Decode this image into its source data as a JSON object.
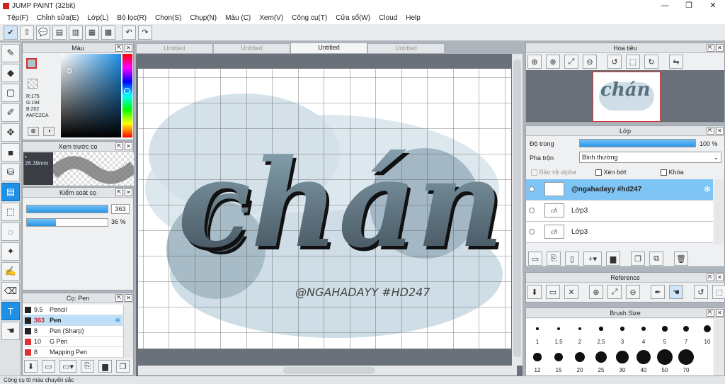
{
  "app": {
    "title": "JUMP PAINT (32bit)"
  },
  "menu": [
    "Tệp(F)",
    "Chỉnh sửa(E)",
    "Lớp(L)",
    "Bộ lọc(R)",
    "Chọn(S)",
    "Chụp(N)",
    "Màu (C)",
    "Xem(V)",
    "Công cụ(T)",
    "Cửa sổ(W)",
    "Cloud",
    "Help"
  ],
  "color_panel": {
    "title": "Màu",
    "r": "R:175",
    "g": "G:194",
    "b": "B:202",
    "hex": "#AFC2CA"
  },
  "preview_panel": {
    "title": "Xem trước cọ",
    "size": "26.39mm"
  },
  "brush_control": {
    "title": "Kiểm soát cọ",
    "size_value": "363",
    "opacity_value": "36 %"
  },
  "brush_panel": {
    "title": "Cọ: Pen",
    "items": [
      {
        "size": "9.5",
        "name": "Pencil",
        "color": "#222222",
        "selected": false
      },
      {
        "size": "363",
        "name": "Pen",
        "color": "#222222",
        "selected": true
      },
      {
        "size": "8",
        "name": "Pen (Sharp)",
        "color": "#222222",
        "selected": false
      },
      {
        "size": "10",
        "name": "G Pen",
        "color": "#e03030",
        "selected": false
      },
      {
        "size": "8",
        "name": "Mapping Pen",
        "color": "#e03030",
        "selected": false
      }
    ]
  },
  "tabs": [
    "Untitled",
    "Untitled",
    "Untitled",
    "Untitled"
  ],
  "canvas": {
    "word": "chán",
    "signature": "@NGAHADAYY #HD247"
  },
  "navigator": {
    "title": "Hoa tiêu"
  },
  "layers_panel": {
    "title": "Lớp",
    "opacity_label": "Độ trong",
    "opacity_value": "100 %",
    "blend_label": "Pha trộn",
    "blend_value": "Bình thường",
    "alpha_label": "Bảo vệ alpha",
    "clip_label": "Xén bớt",
    "lock_label": "Khóa",
    "layers": [
      {
        "name": "@ngahadayy #hd247",
        "selected": true
      },
      {
        "name": "Lớp3",
        "selected": false
      },
      {
        "name": "Lớp3",
        "selected": false
      }
    ]
  },
  "reference_panel": {
    "title": "Reference"
  },
  "brush_size_panel": {
    "title": "Brush Size",
    "row1": [
      "1",
      "1.5",
      "2",
      "2.5",
      "3",
      "4",
      "5",
      "7",
      "10"
    ],
    "row2": [
      "12",
      "15",
      "20",
      "25",
      "30",
      "40",
      "50",
      "70"
    ]
  },
  "status": "Công cụ tô màu chuyển sắc",
  "colors": {
    "accent": "#1e90e6",
    "selected_row": "#7ec4f4"
  }
}
